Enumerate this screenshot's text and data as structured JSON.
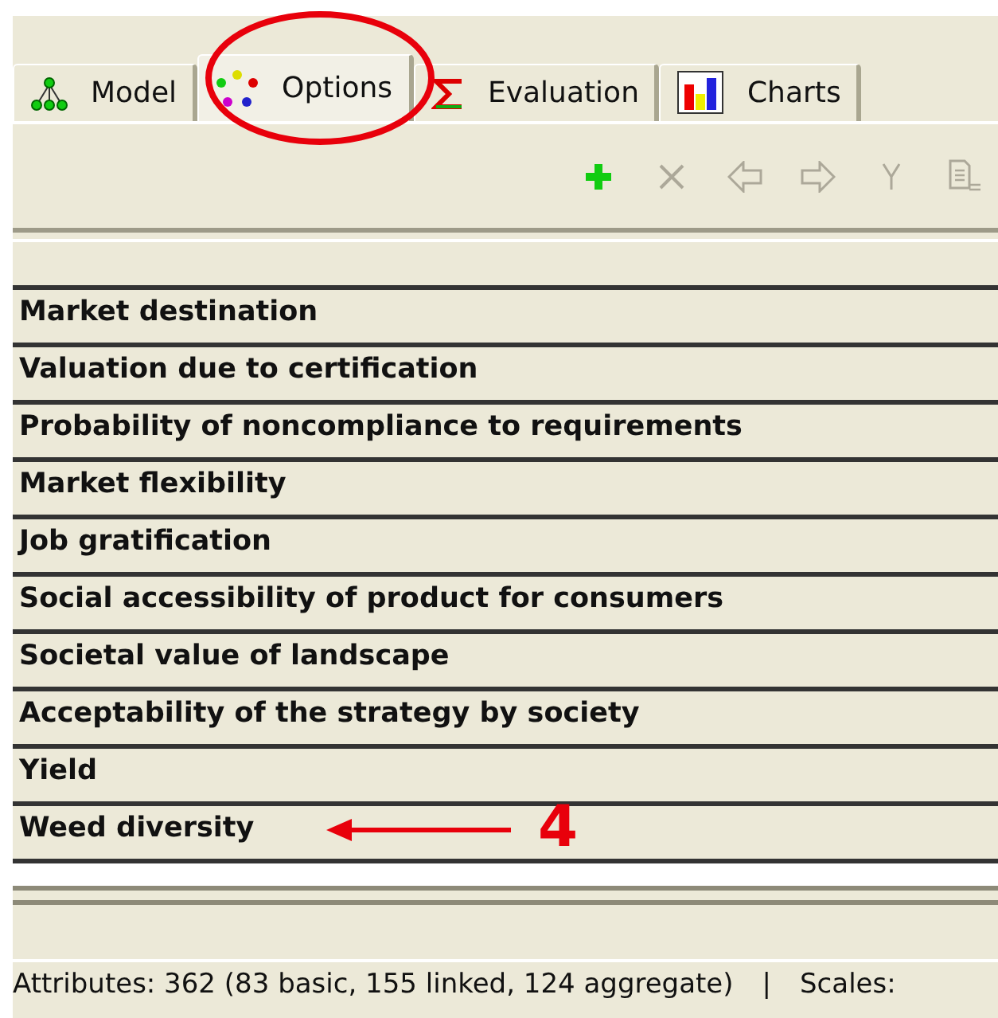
{
  "tabs": [
    {
      "label": "Model",
      "kind": "model",
      "selected": false
    },
    {
      "label": "Options",
      "kind": "options",
      "selected": true
    },
    {
      "label": "Evaluation",
      "kind": "evaluation",
      "selected": false
    },
    {
      "label": "Charts",
      "kind": "charts",
      "selected": false
    }
  ],
  "toolbar": [
    {
      "kind": "add",
      "disabled": false
    },
    {
      "kind": "delete",
      "disabled": true
    },
    {
      "kind": "left",
      "disabled": true
    },
    {
      "kind": "right",
      "disabled": true
    },
    {
      "kind": "fork",
      "disabled": true
    },
    {
      "kind": "copy",
      "disabled": true
    }
  ],
  "rows": [
    {
      "label": "Market destination"
    },
    {
      "label": "Valuation due to certification"
    },
    {
      "label": "Probability of noncompliance to requirements"
    },
    {
      "label": "Market flexibility"
    },
    {
      "label": "Job gratification"
    },
    {
      "label": "Social accessibility of product for consumers"
    },
    {
      "label": "Societal value of landscape"
    },
    {
      "label": "Acceptability of the strategy by society"
    },
    {
      "label": "Yield"
    },
    {
      "label": "Weed diversity",
      "annotation": "4"
    }
  ],
  "status_bar": {
    "attributes": "Attributes: 362 (83 basic, 155 linked, 124 aggregate)",
    "separator": "|",
    "scales": "Scales:"
  }
}
